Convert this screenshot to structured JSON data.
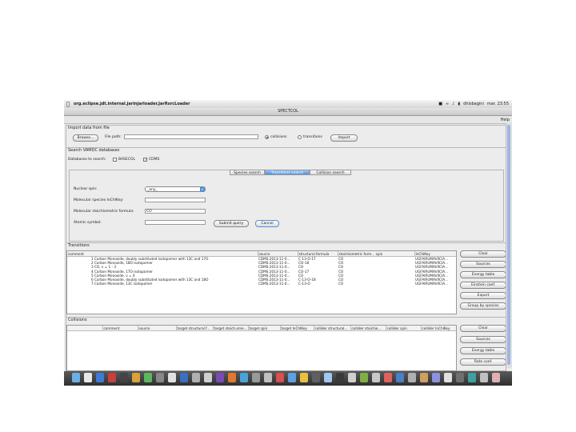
{
  "menubar": {
    "app_name": "org.eclipse.jdt.internal.jarinjarloader.JarRsrcLoader",
    "user": "dhisbagini",
    "clock": "mar. 23:55"
  },
  "window": {
    "title": "SPECTCOL"
  },
  "help_label": "Help",
  "import": {
    "title": "Import data from file",
    "browse_label": "Browse...",
    "file_path_label": "File path:",
    "file_path_value": "",
    "collisions_label": "collisions",
    "transitions_label": "transitions",
    "import_label": "Import"
  },
  "search": {
    "title": "Search VAMDC databases",
    "databases_label": "Databases to search:",
    "db_basecol": "BASECOL",
    "db_cdms": "CDMS",
    "tabs": [
      "Species search",
      "Transitions search",
      "Collision search"
    ],
    "nuclear_spin_label": "Nuclear spin:",
    "nuclear_spin_value": "_any_",
    "inchikey_label": "Molecular species InChIKey:",
    "inchikey_value": "",
    "formula_label": "Molecular stoichiometric formula:",
    "formula_value": "CO",
    "atomic_label": "Atomic symbol:",
    "atomic_value": "",
    "submit_label": "Submit query",
    "cancel_label": "Cancel"
  },
  "transitions": {
    "title": "Transitions",
    "columns": [
      "comment",
      "source",
      "structural formula",
      "stoichiometric form... spin",
      "InChIKey"
    ],
    "rows": [
      [
        "1 Carbon Monoxide, doubly substituted isotopomer with 13C and 17O",
        "CDMS:2013-11-0...",
        "C-13-O-17",
        "CO",
        "UGFAIRUMAVXCIA..."
      ],
      [
        "2 Carbon Monoxide, 18O isotopomer",
        "CDMS:2013-11-0...",
        "CO-18",
        "CO",
        "UGFAIRUMAVXCIA..."
      ],
      [
        "3 CO, v = 1 - 3",
        "CDMS:2013-11-0...",
        "CO",
        "CO",
        "UGFAIRUMAVXCIA..."
      ],
      [
        "4 Carbon Monoxide, 17O isotopomer",
        "CDMS:2013-11-0...",
        "CO-17",
        "CO",
        "UGFAIRUMAVXCIA..."
      ],
      [
        "5 Carbon Monoxide, v = 0",
        "CDMS:2013-11-0...",
        "CO",
        "CO",
        "UGFAIRUMAVXCIA..."
      ],
      [
        "6 Carbon Monoxide, doubly substituted isotopomer with 13C and 18O",
        "CDMS:2013-11-0...",
        "C-13-O-18",
        "CO",
        "UGFAIRUMAVXCIA..."
      ],
      [
        "7 Carbon Monoxide, 13C isotopomer",
        "CDMS:2013-11-0...",
        "C-13-O",
        "CO",
        "UGFAIRUMAVXCIA..."
      ]
    ],
    "buttons": [
      "Clear",
      "Sources",
      "Energy table",
      "Einstein coef.",
      "Export",
      "Group by species"
    ]
  },
  "collisions": {
    "title": "Collisions",
    "columns": [
      "",
      "comment",
      "source",
      "target structural f...",
      "target stoich.ome...",
      "target spin",
      "target InChIKey",
      "collider structural...",
      "collider stoichio...",
      "collider spin",
      "collider InChIKey"
    ],
    "buttons": [
      "Clear",
      "Sources",
      "Energy table",
      "Rate coef."
    ]
  },
  "colors": {
    "accent": "#4f8fe0",
    "dock": "#3a3a3a"
  }
}
